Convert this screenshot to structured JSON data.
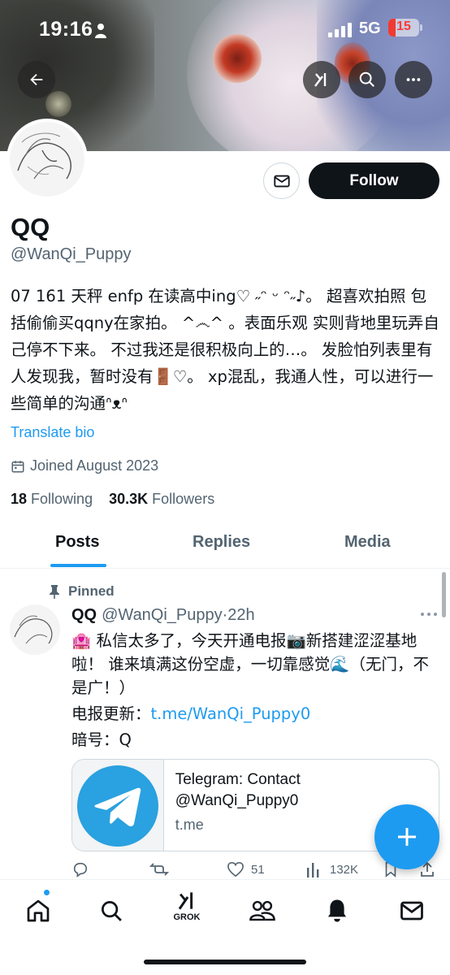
{
  "status_bar": {
    "time": "19:16",
    "network": "5G",
    "battery": "15",
    "battery_color": "#ef3b33"
  },
  "header": {
    "back_icon": "arrow-left-icon",
    "grok_icon": "grok-icon",
    "search_icon": "search-icon",
    "more_icon": "more-horizontal-icon"
  },
  "profile": {
    "name": "QQ",
    "handle": "@WanQi_Puppy",
    "bio": "07 161 天秤 enfp 在读高中ing♡ ˶ᵔ ᵕ ᵔ˶♪。 超喜欢拍照 包括偷偷买qqny在家拍。 ^෴^ 。表面乐观 实则背地里玩弄自己停不下来。 不过我还是很积极向上的…。 发脸怕列表里有人发现我，暂时没有🚪♡。 xp混乱，我通人性，可以进行一些简单的沟通ᐢᴥᐢ",
    "translate_label": "Translate bio",
    "joined": "Joined August 2023",
    "following_count": "18",
    "following_label": "Following",
    "followers_count": "30.3K",
    "followers_label": "Followers",
    "follow_button": "Follow",
    "accent_color": "#1d9bf0"
  },
  "tabs": [
    {
      "label": "Posts",
      "active": true
    },
    {
      "label": "Replies",
      "active": false
    },
    {
      "label": "Media",
      "active": false
    }
  ],
  "pinned_post": {
    "pinned_label": "Pinned",
    "author_name": "QQ",
    "author_handle": "@WanQi_Puppy",
    "time": "·22h",
    "text_line1": "🏩 私信太多了，今天开通电报📷新搭建涩涩基地啦！ 谁来填满这份空虚，一切靠感觉🌊（无门，不是广！）",
    "text_line2_prefix": "电报更新：",
    "text_line2_link": "t.me/WanQi_Puppy0",
    "text_line3": "暗号：Q",
    "card": {
      "title": "Telegram: Contact @WanQi_Puppy0",
      "domain": "t.me"
    },
    "stats": {
      "likes": "51",
      "views": "132K"
    }
  },
  "bottom_nav": {
    "grok_label": "GROK"
  }
}
